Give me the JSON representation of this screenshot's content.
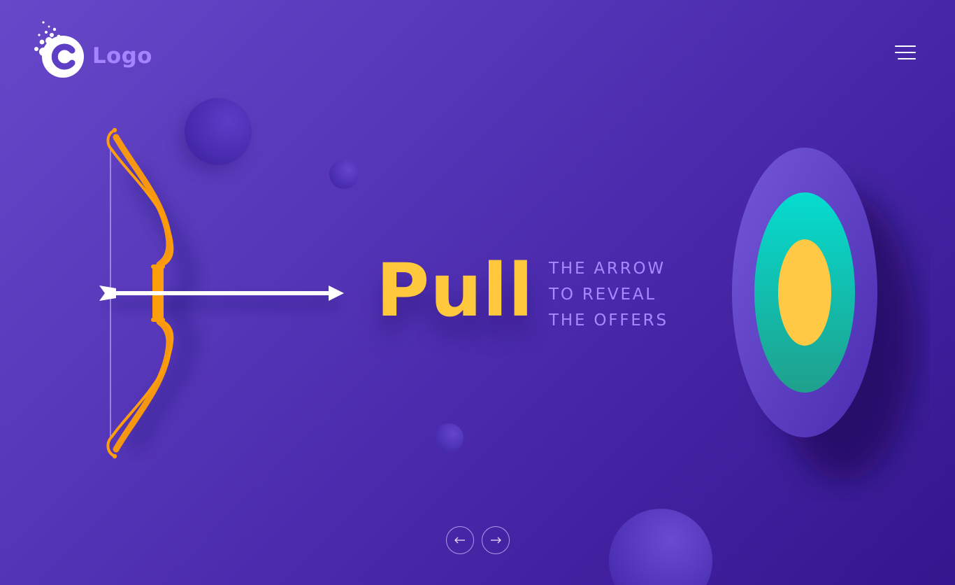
{
  "header": {
    "logo_text": "Logo",
    "logo_icon": "c-bubbles-logo-icon",
    "menu_icon": "hamburger-menu-icon"
  },
  "hero": {
    "headline": "Pull",
    "tagline": [
      "THE ARROW",
      "TO REVEAL",
      "THE OFFERS"
    ],
    "bow_icon": "bow-and-arrow-illustration",
    "target_icon": "archery-target-illustration"
  },
  "pagination": {
    "prev_icon": "arrow-left-icon",
    "next_icon": "arrow-right-icon"
  },
  "colors": {
    "background_start": "#6748c9",
    "background_end": "#35168d",
    "accent_yellow": "#ffc83d",
    "bow_orange": "#ff9d0a",
    "tagline_lavender": "#a889ff",
    "logo_text": "#a684ff",
    "target_outer": "#6a4bd0",
    "target_middle": "#13c9b4",
    "target_center": "#ffc845"
  }
}
